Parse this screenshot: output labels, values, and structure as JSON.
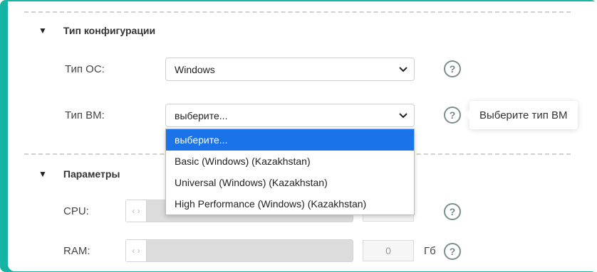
{
  "config_section": {
    "title": "Тип конфигурации"
  },
  "os_field": {
    "label": "Тип ОС:",
    "value": "Windows"
  },
  "vm_field": {
    "label": "Тип ВМ:",
    "value": "выберите...",
    "tooltip": "Выберите тип ВМ",
    "options": [
      "выберите...",
      "Basic (Windows) (Kazakhstan)",
      "Universal (Windows) (Kazakhstan)",
      "High Performance (Windows) (Kazakhstan)"
    ],
    "selected_index": 0
  },
  "params_section": {
    "title": "Параметры"
  },
  "cpu_field": {
    "label": "CPU:",
    "handle": "‹ ›"
  },
  "ram_field": {
    "label": "RAM:",
    "value": "0",
    "unit": "Гб",
    "handle": "‹ ›"
  },
  "help_icon_text": "?",
  "colors": {
    "accent": "#14b3a3",
    "highlight": "#1a73e8"
  }
}
